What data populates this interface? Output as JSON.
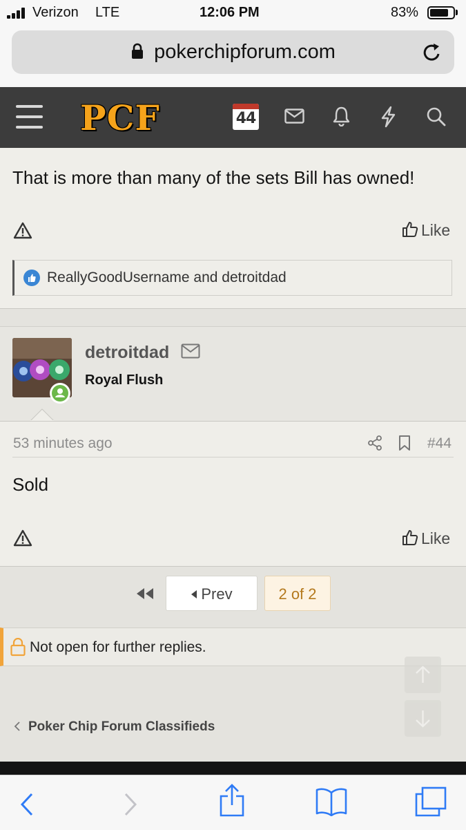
{
  "status": {
    "carrier": "Verizon",
    "network": "LTE",
    "time": "12:06 PM",
    "battery": "83%",
    "battery_level": 0.83
  },
  "browser": {
    "url": "pokerchipforum.com"
  },
  "header": {
    "logo": "PCF",
    "calendar_day": "44",
    "icons": [
      "menu-icon",
      "calendar-icon",
      "inbox-icon",
      "bell-icon",
      "lightning-icon",
      "search-icon"
    ]
  },
  "post1": {
    "text": "That is more than many of the sets Bill has owned!",
    "like_label": "Like",
    "likes_text": "ReallyGoodUsername and detroitdad"
  },
  "post2": {
    "username": "detroitdad",
    "user_title": "Royal Flush",
    "time": "53 minutes ago",
    "post_number": "#44",
    "text": "Sold",
    "like_label": "Like"
  },
  "pagination": {
    "prev_label": "Prev",
    "current": "2 of 2"
  },
  "notice": "Not open for further replies.",
  "breadcrumb": "Poker Chip Forum Classifieds",
  "colors": {
    "logo": "#f5a31b",
    "header_bg": "#3c3c3c",
    "accent": "#f1a43a",
    "ios_blue": "#2f7bf6"
  }
}
